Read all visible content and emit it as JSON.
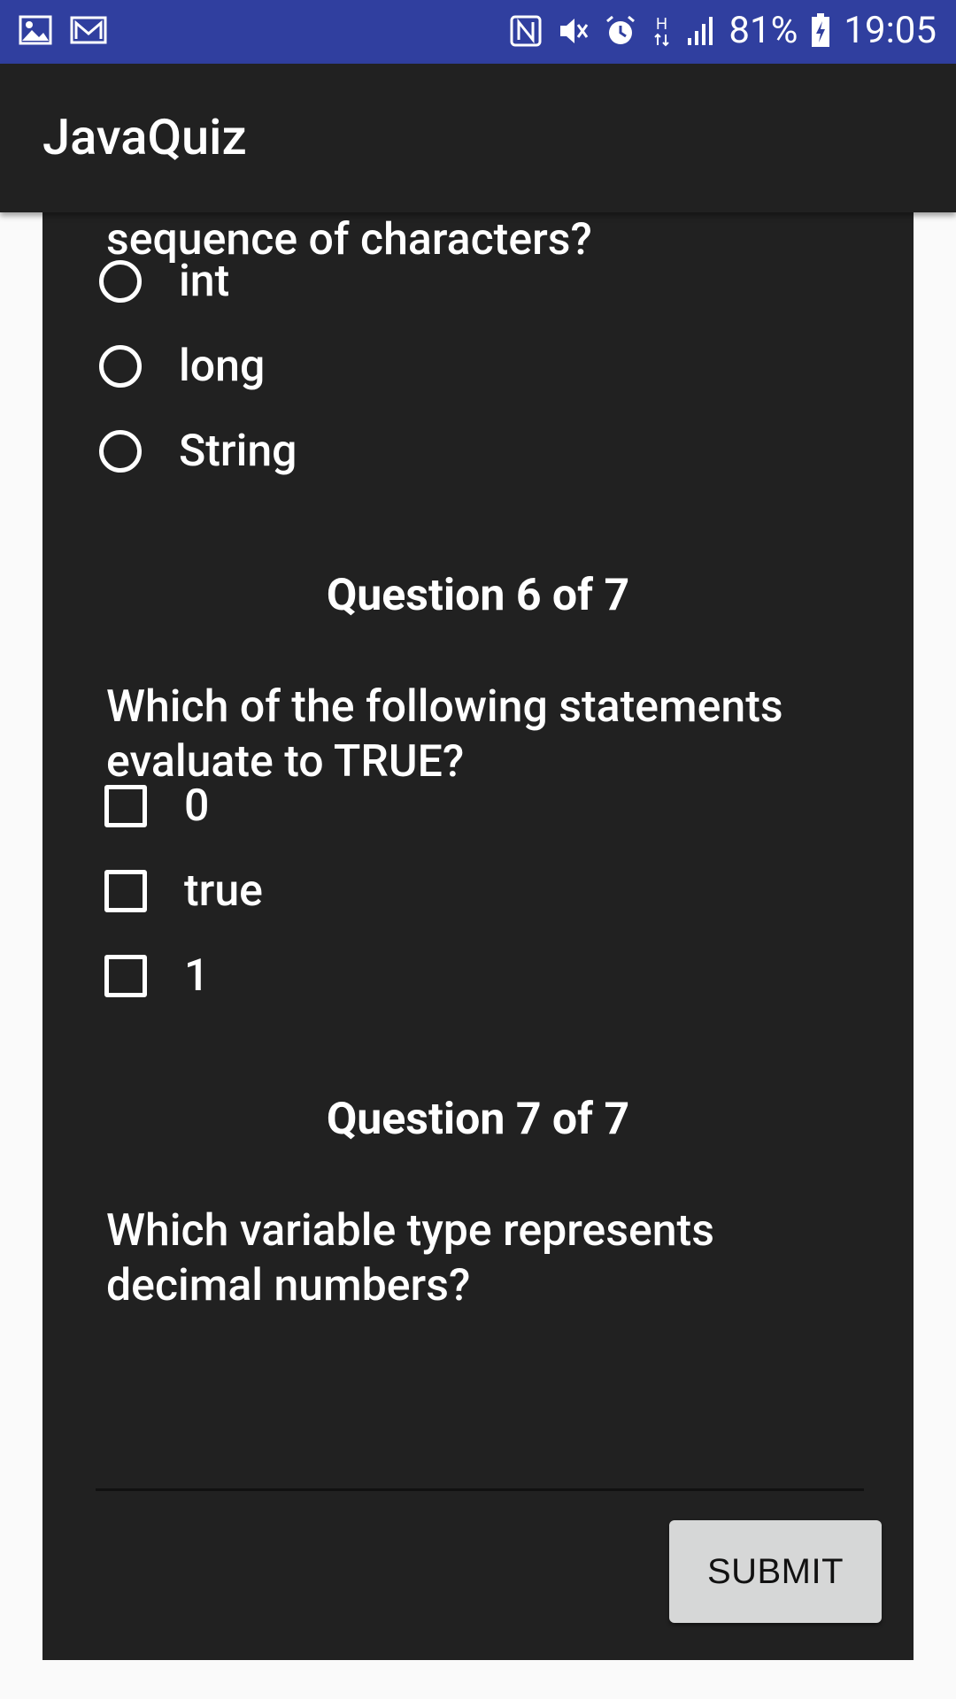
{
  "status_bar": {
    "left_icons": [
      "image-icon",
      "mail-icon"
    ],
    "right_icons": [
      "nfc-icon",
      "vibrate-icon",
      "alarm-icon",
      "data-h-icon",
      "signal-icon",
      "battery-icon"
    ],
    "battery_percent": "81%",
    "time": "19:05",
    "color": "#303f9f"
  },
  "app_bar": {
    "title": "JavaQuiz",
    "color": "#212121"
  },
  "quiz": {
    "q5": {
      "text_fragment": "sequence of characters?",
      "options": [
        "int",
        "long",
        "String"
      ]
    },
    "q6": {
      "heading": "Question 6 of 7",
      "text": "Which of the following statements evaluate to TRUE?",
      "options": [
        "0",
        "true",
        "1"
      ]
    },
    "q7": {
      "heading": "Question 7 of 7",
      "text": "Which variable type represents decimal numbers?",
      "answer_value": ""
    },
    "submit_label": "SUBMIT"
  }
}
